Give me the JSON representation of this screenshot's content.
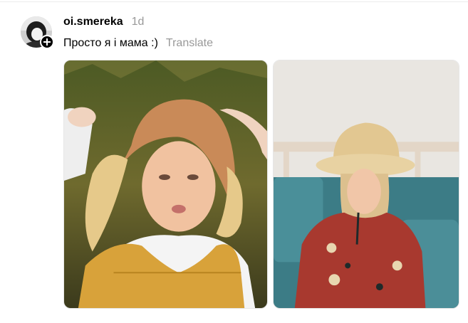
{
  "post": {
    "username": "oi.smereka",
    "time": "1d",
    "caption": "Просто я і мама :)",
    "translate_label": "Translate"
  },
  "media": [
    {
      "kind": "photo",
      "subject": "young woman lying on grass wearing a crochet bucket hat and mustard top"
    },
    {
      "kind": "photo",
      "subject": "woman in straw hat and red embroidered dress sitting on a teal sofa"
    }
  ],
  "icons": {
    "avatar": "profile-picture",
    "follow": "plus-icon"
  },
  "colors": {
    "text": "#000000",
    "muted": "#999999",
    "background": "#ffffff"
  }
}
